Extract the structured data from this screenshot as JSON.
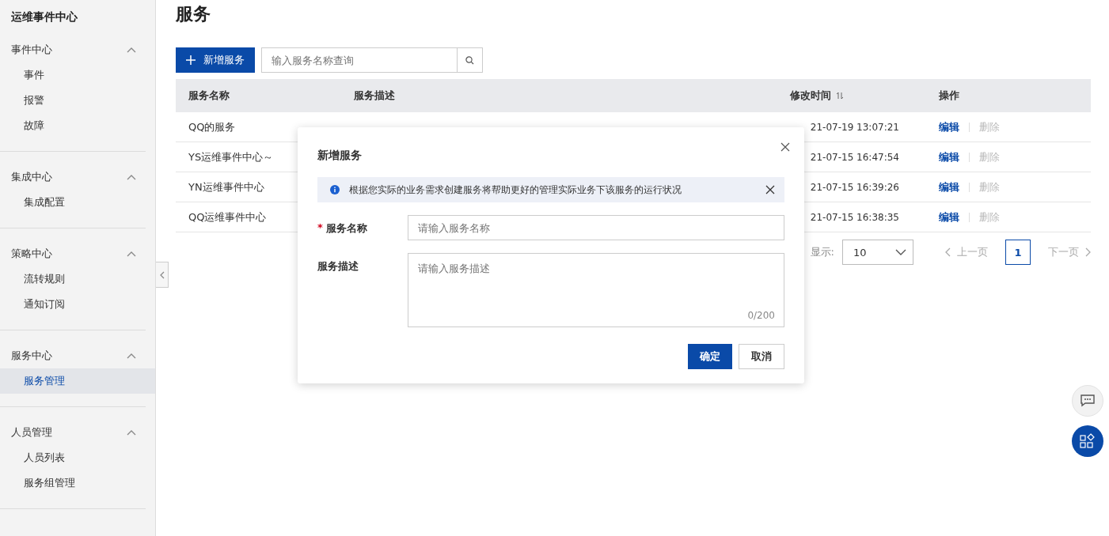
{
  "sidebar": {
    "title": "运维事件中心",
    "groups": [
      {
        "label": "事件中心",
        "expanded": true,
        "items": [
          {
            "label": "事件",
            "selected": false
          },
          {
            "label": "报警",
            "selected": false
          },
          {
            "label": "故障",
            "selected": false
          }
        ]
      },
      {
        "label": "集成中心",
        "expanded": true,
        "items": [
          {
            "label": "集成配置",
            "selected": false
          }
        ]
      },
      {
        "label": "策略中心",
        "expanded": true,
        "items": [
          {
            "label": "流转规则",
            "selected": false
          },
          {
            "label": "通知订阅",
            "selected": false
          }
        ]
      },
      {
        "label": "服务中心",
        "expanded": true,
        "items": [
          {
            "label": "服务管理",
            "selected": true
          }
        ]
      },
      {
        "label": "人员管理",
        "expanded": true,
        "items": [
          {
            "label": "人员列表",
            "selected": false
          },
          {
            "label": "服务组管理",
            "selected": false
          }
        ]
      }
    ]
  },
  "page": {
    "title": "服务",
    "add_button": "新增服务",
    "search": {
      "placeholder": "输入服务名称查询"
    },
    "table": {
      "columns": [
        {
          "label": "服务名称"
        },
        {
          "label": "服务描述"
        },
        {
          "label": "修改时间",
          "sortable": true
        },
        {
          "label": "操作"
        }
      ],
      "rows": [
        {
          "name": "QQ的服务",
          "modified": "21-07-19 13:07:21",
          "actions": [
            {
              "label": "编辑",
              "disabled": false
            },
            {
              "label": "删除",
              "disabled": true
            }
          ]
        },
        {
          "name": "YS运维事件中心～",
          "modified": "21-07-15 16:47:54",
          "actions": [
            {
              "label": "编辑",
              "disabled": false
            },
            {
              "label": "删除",
              "disabled": true
            }
          ]
        },
        {
          "name": "YN运维事件中心",
          "modified": "21-07-15 16:39:26",
          "actions": [
            {
              "label": "编辑",
              "disabled": false
            },
            {
              "label": "删除",
              "disabled": true
            }
          ]
        },
        {
          "name": "QQ运维事件中心",
          "modified": "21-07-15 16:38:35",
          "actions": [
            {
              "label": "编辑",
              "disabled": false
            },
            {
              "label": "删除",
              "disabled": true
            }
          ]
        }
      ]
    },
    "pagination": {
      "page_size_label": "显示:",
      "page_size": "10",
      "prev": {
        "label": "上一页",
        "disabled": true
      },
      "pages": [
        {
          "label": "1",
          "selected": true
        }
      ],
      "next": {
        "label": "下一页",
        "disabled": true
      }
    }
  },
  "dialog": {
    "title": "新增服务",
    "notice": "根据您实际的业务需求创建服务将帮助更好的管理实际业务下该服务的运行状况",
    "fields": [
      {
        "kind": "input",
        "label": "服务名称",
        "required_mark": "*",
        "placeholder": "请输入服务名称"
      },
      {
        "kind": "textarea",
        "label": "服务描述",
        "placeholder": "请输入服务描述",
        "counter": "0/200"
      }
    ],
    "buttons": [
      {
        "label": "确定",
        "kind": "primary"
      },
      {
        "label": "取消",
        "kind": "default"
      }
    ]
  }
}
